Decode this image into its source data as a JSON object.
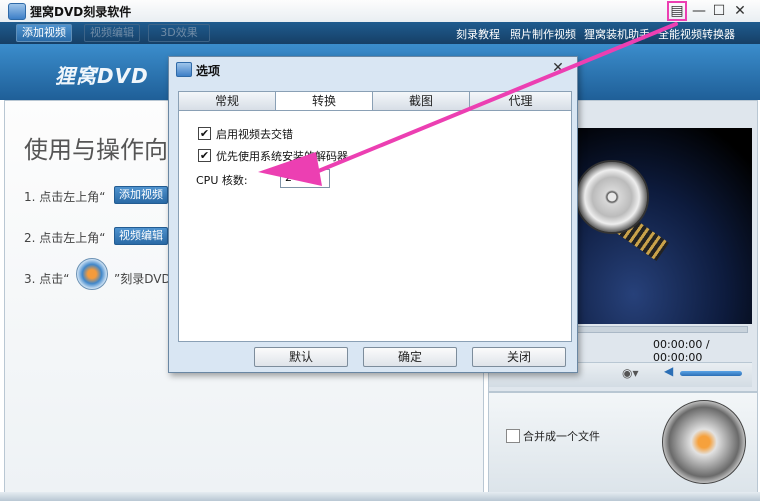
{
  "app": {
    "title": "狸窝DVD刻录软件",
    "logo_text": "狸窝DVD"
  },
  "toolbar": {
    "add_video": "添加视频",
    "edit_video": "视频编辑",
    "effect_3d": "3D效果",
    "links": [
      "刻录教程",
      "照片制作视频",
      "狸窝装机助手",
      "全能视频转换器"
    ]
  },
  "guide": {
    "title": "使用与操作向",
    "step1": "1. 点击左上角“",
    "step1_btn": "添加视频",
    "step2": "2. 点击左上角“",
    "step2_btn": "视频编辑",
    "step3": "3. 点击“",
    "step3_tail": "”刻录DVD"
  },
  "player": {
    "time": "00:00:00 / 00:00:00",
    "volume": 0.9
  },
  "merge": {
    "label": "合并成一个文件",
    "checked": false
  },
  "dialog": {
    "title": "选项",
    "tabs": [
      "常规",
      "转换",
      "截图",
      "代理"
    ],
    "active_tab": "转换",
    "option1": "启用视频去交错",
    "option1_checked": true,
    "option2": "优先使用系统安装的解码器",
    "option2_checked": true,
    "cpu_label": "CPU 核数:",
    "cpu_value": "2",
    "buttons": {
      "default": "默认",
      "ok": "确定",
      "close": "关闭"
    }
  },
  "icons": {
    "check": "✔",
    "dropdown": "▼",
    "close": "✕",
    "minimize": "—",
    "maximize": "☐",
    "menu": "▤"
  },
  "colors": {
    "accent": "#2a6aa6",
    "annotation": "#ec3fb2"
  }
}
